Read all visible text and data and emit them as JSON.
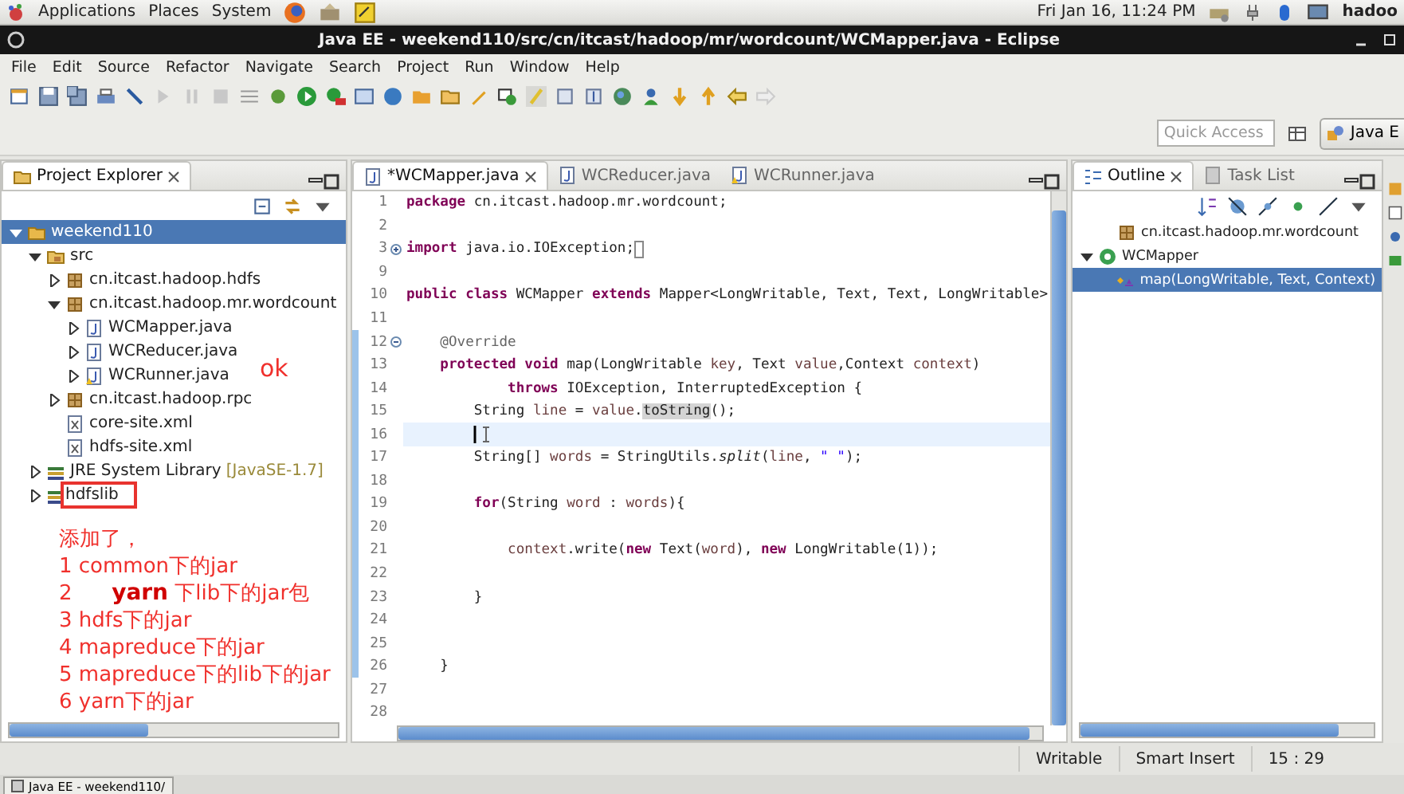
{
  "top_panel": {
    "menus": [
      "Applications",
      "Places",
      "System"
    ],
    "clock": "Fri Jan 16, 11:24 PM",
    "user": "hadoo"
  },
  "window": {
    "title": "Java EE - weekend110/src/cn/itcast/hadoop/mr/wordcount/WCMapper.java - Eclipse"
  },
  "menu": [
    "File",
    "Edit",
    "Source",
    "Refactor",
    "Navigate",
    "Search",
    "Project",
    "Run",
    "Window",
    "Help"
  ],
  "quick_access": {
    "placeholder": "Quick Access"
  },
  "perspective": {
    "label": "Java E"
  },
  "project_explorer": {
    "title": "Project Explorer",
    "tree": [
      {
        "label": "weekend110",
        "kind": "project",
        "expanded": true,
        "selected": true,
        "children": [
          {
            "label": "src",
            "kind": "source-folder",
            "expanded": true,
            "selected": false,
            "children": [
              {
                "label": "cn.itcast.hadoop.hdfs",
                "kind": "package",
                "expanded": false,
                "selected": false
              },
              {
                "label": "cn.itcast.hadoop.mr.wordcount",
                "kind": "package",
                "expanded": true,
                "selected": false,
                "children": [
                  {
                    "label": "WCMapper.java",
                    "kind": "java",
                    "expanded": false,
                    "selected": false
                  },
                  {
                    "label": "WCReducer.java",
                    "kind": "java",
                    "expanded": false,
                    "selected": false
                  },
                  {
                    "label": "WCRunner.java",
                    "kind": "java-warning",
                    "expanded": false,
                    "selected": false
                  }
                ]
              },
              {
                "label": "cn.itcast.hadoop.rpc",
                "kind": "package",
                "expanded": false,
                "selected": false
              },
              {
                "label": "core-site.xml",
                "kind": "xml",
                "selected": false
              },
              {
                "label": "hdfs-site.xml",
                "kind": "xml",
                "selected": false
              }
            ]
          },
          {
            "label": "JRE System Library",
            "decoration": "[JavaSE-1.7]",
            "kind": "library",
            "expanded": false,
            "selected": false
          },
          {
            "label": "hdfslib",
            "kind": "library",
            "expanded": false,
            "selected": false,
            "boxed": true
          }
        ]
      }
    ],
    "annotation_side": "ok",
    "annotations": [
      "添加了，",
      "1 common下的jar",
      "2      **yarn** 下lib下的jar包",
      "3 hdfs下的jar",
      "4 mapreduce下的jar",
      "5 mapreduce下的lib下的jar",
      "6 yarn下的jar"
    ]
  },
  "editor": {
    "tabs": [
      {
        "label": "*WCMapper.java",
        "kind": "java",
        "selected": true
      },
      {
        "label": "WCReducer.java",
        "kind": "java",
        "selected": false
      },
      {
        "label": "WCRunner.java",
        "kind": "java-warning",
        "selected": false
      }
    ],
    "lines": [
      {
        "number": "1",
        "changed": false,
        "current": false,
        "tokens": [
          {
            "kind": "kw",
            "text": "package"
          },
          {
            "kind": "plain",
            "text": " cn.itcast.hadoop.mr.wordcount;"
          }
        ]
      },
      {
        "number": "2",
        "changed": false,
        "current": false
      },
      {
        "number": "3",
        "changed": false,
        "current": false,
        "folded": true,
        "tokens": [
          {
            "kind": "kw",
            "text": "import"
          },
          {
            "kind": "plain",
            "text": " java.io.IOException;"
          }
        ]
      },
      {
        "number": "9",
        "changed": false,
        "current": false
      },
      {
        "number": "10",
        "changed": false,
        "current": false,
        "tokens": [
          {
            "kind": "kw",
            "text": "public class"
          },
          {
            "kind": "plain",
            "text": " WCMapper "
          },
          {
            "kind": "kw",
            "text": "extends"
          },
          {
            "kind": "plain",
            "text": " Mapper<LongWritable, Text, Text, LongWritable>"
          }
        ]
      },
      {
        "number": "11",
        "changed": false,
        "current": false
      },
      {
        "number": "12",
        "changed": true,
        "current": false,
        "folded": false,
        "tokens": [
          {
            "kind": "ann",
            "text": "    @Override"
          }
        ]
      },
      {
        "number": "13",
        "changed": true,
        "current": false,
        "tokens": [
          {
            "kind": "kw",
            "text": "    protected void"
          },
          {
            "kind": "plain",
            "text": " map(LongWritable "
          },
          {
            "kind": "var",
            "text": "key"
          },
          {
            "kind": "plain",
            "text": ", Text "
          },
          {
            "kind": "var",
            "text": "value"
          },
          {
            "kind": "plain",
            "text": ",Context "
          },
          {
            "kind": "var",
            "text": "context"
          },
          {
            "kind": "plain",
            "text": ")"
          }
        ]
      },
      {
        "number": "14",
        "changed": true,
        "current": false,
        "tokens": [
          {
            "kind": "kw",
            "text": "            throws"
          },
          {
            "kind": "plain",
            "text": " IOException, InterruptedException {"
          }
        ]
      },
      {
        "number": "15",
        "changed": true,
        "current": false,
        "tokens": [
          {
            "kind": "plain",
            "text": "        String "
          },
          {
            "kind": "var",
            "text": "line"
          },
          {
            "kind": "plain",
            "text": " = "
          },
          {
            "kind": "var",
            "text": "value"
          },
          {
            "kind": "plain",
            "text": "."
          },
          {
            "kind": "occ",
            "text": "toString"
          },
          {
            "kind": "plain",
            "text": "();"
          }
        ]
      },
      {
        "number": "16",
        "changed": true,
        "current": true
      },
      {
        "number": "17",
        "changed": true,
        "current": false,
        "tokens": [
          {
            "kind": "plain",
            "text": "        String[] "
          },
          {
            "kind": "var",
            "text": "words"
          },
          {
            "kind": "plain",
            "text": " = StringUtils."
          },
          {
            "kind": "italic",
            "text": "split"
          },
          {
            "kind": "plain",
            "text": "("
          },
          {
            "kind": "var",
            "text": "line"
          },
          {
            "kind": "plain",
            "text": ", "
          },
          {
            "kind": "str",
            "text": "\" \""
          },
          {
            "kind": "plain",
            "text": ");"
          }
        ]
      },
      {
        "number": "18",
        "changed": true,
        "current": false
      },
      {
        "number": "19",
        "changed": true,
        "current": false,
        "tokens": [
          {
            "kind": "kw",
            "text": "        for"
          },
          {
            "kind": "plain",
            "text": "(String "
          },
          {
            "kind": "var",
            "text": "word"
          },
          {
            "kind": "plain",
            "text": " : "
          },
          {
            "kind": "var",
            "text": "words"
          },
          {
            "kind": "plain",
            "text": "){"
          }
        ]
      },
      {
        "number": "20",
        "changed": true,
        "current": false
      },
      {
        "number": "21",
        "changed": true,
        "current": false,
        "tokens": [
          {
            "kind": "var",
            "text": "            context"
          },
          {
            "kind": "plain",
            "text": ".write("
          },
          {
            "kind": "kw",
            "text": "new"
          },
          {
            "kind": "plain",
            "text": " Text("
          },
          {
            "kind": "var",
            "text": "word"
          },
          {
            "kind": "plain",
            "text": "), "
          },
          {
            "kind": "kw",
            "text": "new"
          },
          {
            "kind": "plain",
            "text": " LongWritable(1));"
          }
        ]
      },
      {
        "number": "22",
        "changed": true,
        "current": false
      },
      {
        "number": "23",
        "changed": true,
        "current": false,
        "tokens": [
          {
            "kind": "plain",
            "text": "        }"
          }
        ]
      },
      {
        "number": "24",
        "changed": true,
        "current": false
      },
      {
        "number": "25",
        "changed": true,
        "current": false
      },
      {
        "number": "26",
        "changed": true,
        "current": false,
        "tokens": [
          {
            "kind": "plain",
            "text": "    }"
          }
        ]
      },
      {
        "number": "27",
        "changed": false,
        "current": false
      },
      {
        "number": "28",
        "changed": false,
        "current": false
      }
    ]
  },
  "outline": {
    "tabs": [
      {
        "label": "Outline",
        "selected": true
      },
      {
        "label": "Task List",
        "selected": false
      }
    ],
    "tree": [
      {
        "label": "cn.itcast.hadoop.mr.wordcount",
        "kind": "package",
        "selected": false
      },
      {
        "label": "WCMapper",
        "kind": "class",
        "expanded": true,
        "selected": false,
        "children": [
          {
            "label": "map(LongWritable, Text, Context)",
            "kind": "method",
            "selected": true
          }
        ]
      }
    ]
  },
  "status_bar": [
    "Writable",
    "Smart Insert",
    "15 : 29"
  ],
  "taskbar": [
    {
      "label": "Java EE - weekend110/"
    }
  ]
}
